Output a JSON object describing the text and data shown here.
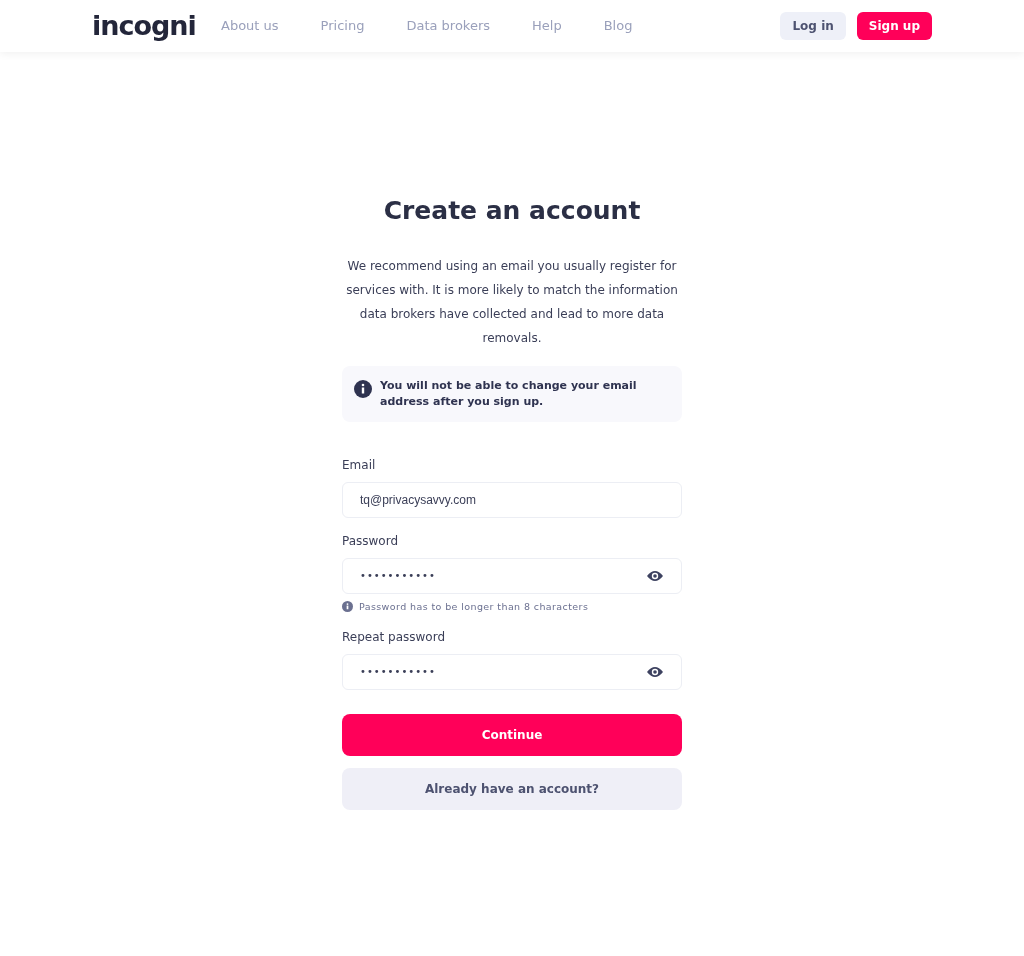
{
  "header": {
    "logo": "incogni",
    "nav": [
      "About us",
      "Pricing",
      "Data brokers",
      "Help",
      "Blog"
    ],
    "login_button": "Log in",
    "signup_button": "Sign up"
  },
  "form": {
    "title": "Create an account",
    "intro": "We recommend using an email you usually register for services with. It is more likely to match the information data brokers have collected and lead to more data removals.",
    "notice": "You will not be able to change your email address after you sign up.",
    "fields": [
      {
        "label": "Email",
        "value": "tq@privacysavvy.com",
        "kind": "text"
      },
      {
        "label": "Password",
        "value": "•••••••••••",
        "kind": "password",
        "hint": "Password has to be longer than 8 characters"
      },
      {
        "label": "Repeat password",
        "value": "•••••••••••",
        "kind": "password"
      }
    ],
    "continue_button": "Continue",
    "existing_account_button": "Already have an account?"
  }
}
